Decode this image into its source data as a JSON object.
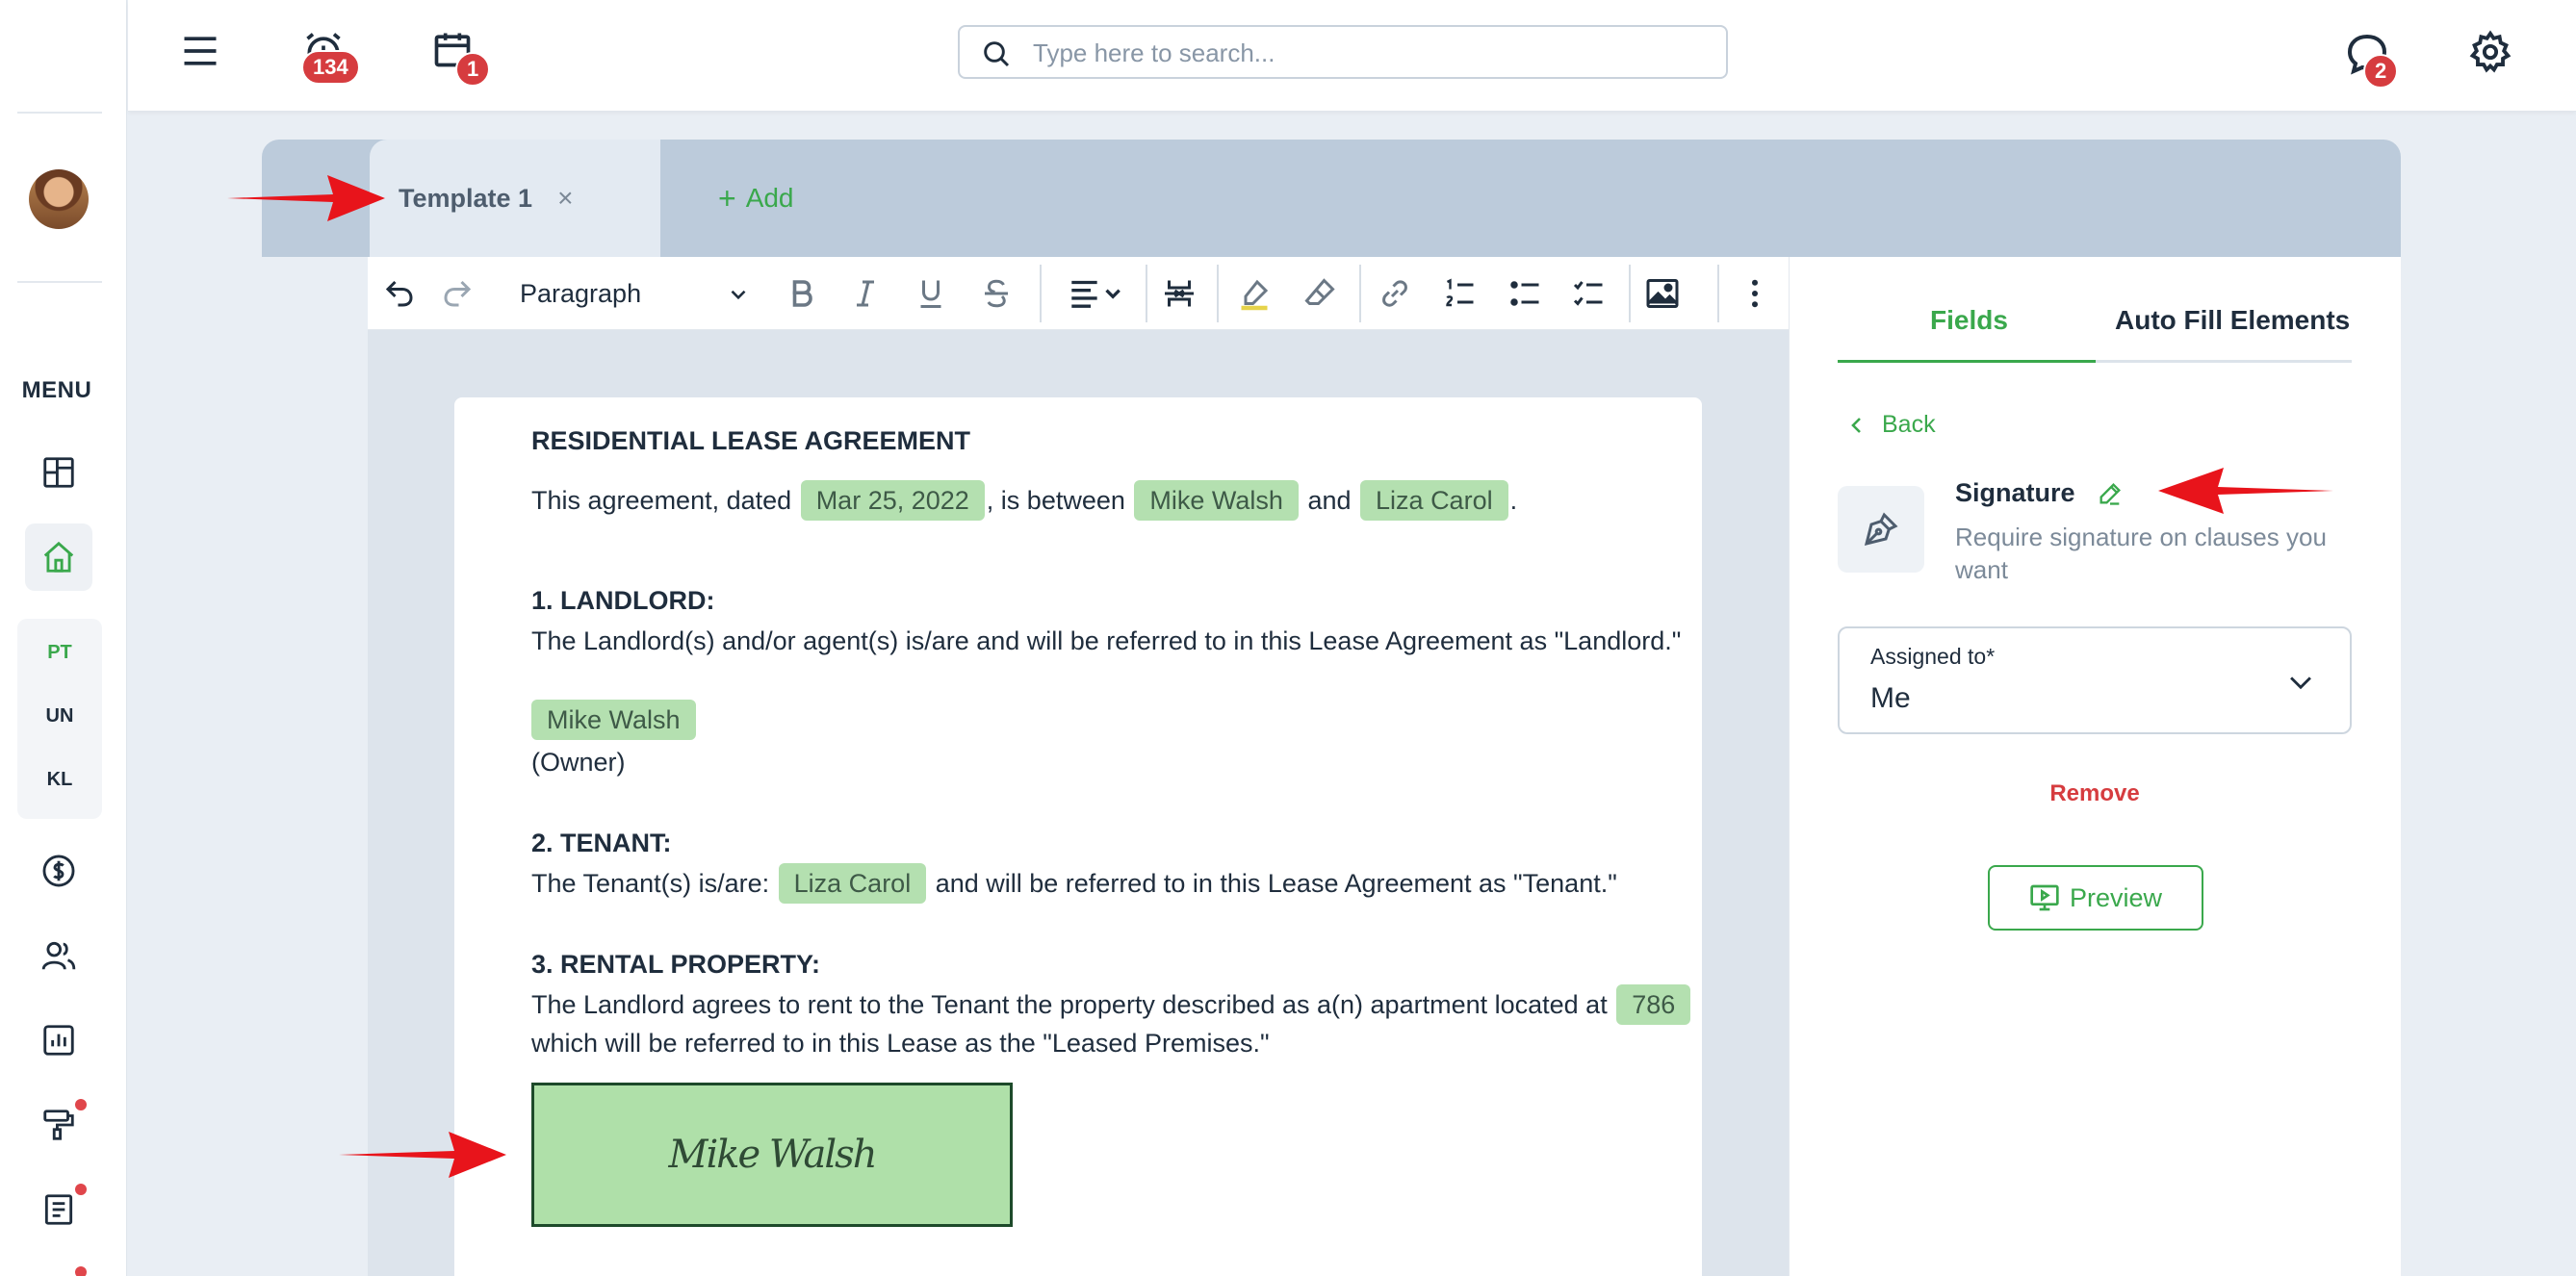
{
  "topbar": {
    "alarm_count": "134",
    "calendar_count": "1",
    "messages_count": "2",
    "search_placeholder": "Type here to search..."
  },
  "sidebar": {
    "menu_label": "MENU",
    "group_items": [
      "PT",
      "UN",
      "KL"
    ]
  },
  "tabs": {
    "active_label": "Template 1",
    "close_glyph": "×",
    "add_label": "Add"
  },
  "toolbar": {
    "block_format": "Paragraph"
  },
  "document": {
    "title": "RESIDENTIAL LEASE AGREEMENT",
    "intro_prefix": "This agreement, dated",
    "intro_date": "Mar 25, 2022",
    "intro_between": ", is between",
    "landlord_name": "Mike Walsh",
    "intro_and": "and",
    "tenant_name": "Liza Carol",
    "intro_end": ".",
    "section1_heading": "1. LANDLORD:",
    "section1_text": "The Landlord(s) and/or agent(s) is/are and will be referred to in this Lease Agreement as \"Landlord.\"",
    "owner_name": "Mike Walsh",
    "owner_label": "(Owner)",
    "section2_heading": "2. TENANT:",
    "section2_prefix": "The Tenant(s) is/are:",
    "section2_tenant": "Liza Carol",
    "section2_suffix": "and will be referred to in this Lease Agreement as \"Tenant.\"",
    "section3_heading": "3. RENTAL PROPERTY:",
    "section3_text": "The Landlord agrees to rent to the Tenant the property described as a(n) apartment located at",
    "section3_address_partial": "786",
    "section3_text2": " which will be referred to in this Lease as the \"Leased Premises.\"",
    "signature_text": "Mike Walsh"
  },
  "fields_panel": {
    "tab_fields": "Fields",
    "tab_auto_fill": "Auto Fill Elements",
    "back_label": "Back",
    "field_title": "Signature",
    "field_description": "Require signature on clauses you want",
    "assigned_label": "Assigned to*",
    "assigned_value": "Me",
    "remove_label": "Remove",
    "preview_label": "Preview"
  },
  "colors": {
    "accent_green": "#3aa84c",
    "chip_green": "#b4e0b0",
    "badge_red": "#d63c3f",
    "annotation_red": "#e8141b"
  }
}
